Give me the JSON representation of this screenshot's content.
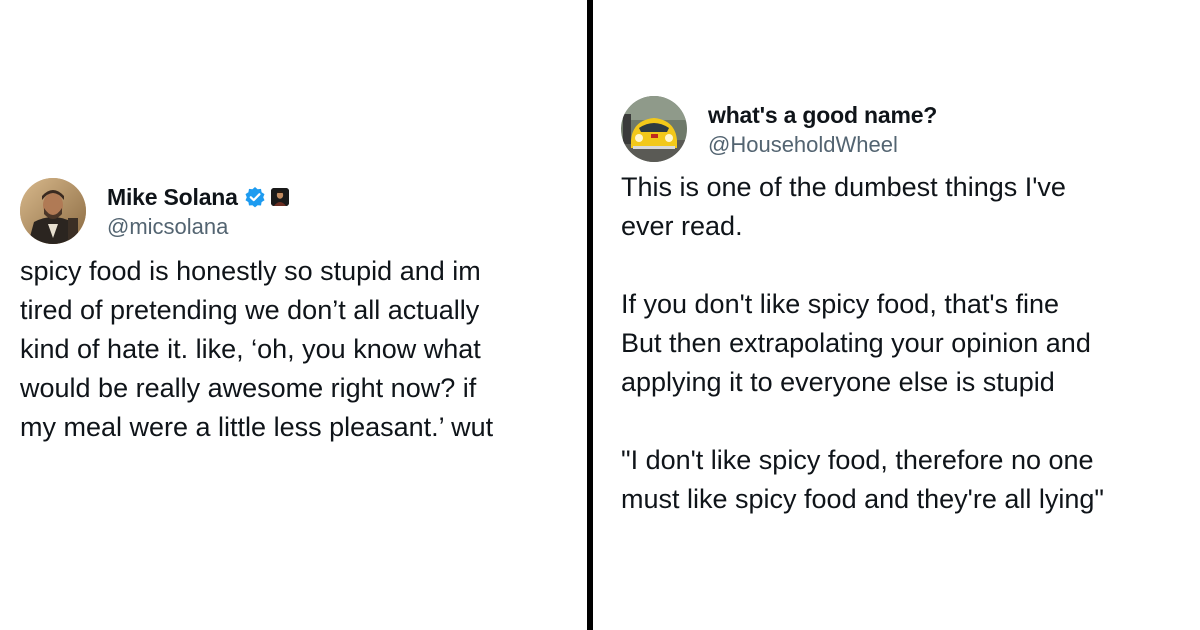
{
  "left_tweet": {
    "display_name": "Mike Solana",
    "handle": "@micsolana",
    "verified_icon": "verified-badge-icon",
    "affiliation_icon": "affiliate-portrait-icon",
    "accent_color": "#1d9bf0",
    "lines": [
      "spicy food is honestly so stupid and im",
      "tired of pretending we don’t all actually",
      "kind of hate it. like, ‘oh, you know what",
      "would be really awesome right now? if",
      "my meal were a little less pleasant.’ wut"
    ]
  },
  "right_tweet": {
    "display_name": "what's a good name?",
    "handle": "@HouseholdWheel",
    "paragraphs": [
      [
        "This is one of the dumbest things I've",
        "ever read."
      ],
      [
        "If you don't like spicy food, that's fine",
        "But then extrapolating your opinion and",
        "applying it to everyone else is stupid"
      ],
      [
        "\"I don't like spicy food, therefore no one",
        "must like spicy food and they're all lying\""
      ]
    ]
  },
  "colors": {
    "text": "#0f1419",
    "secondary": "#536471",
    "divider": "#000000"
  }
}
